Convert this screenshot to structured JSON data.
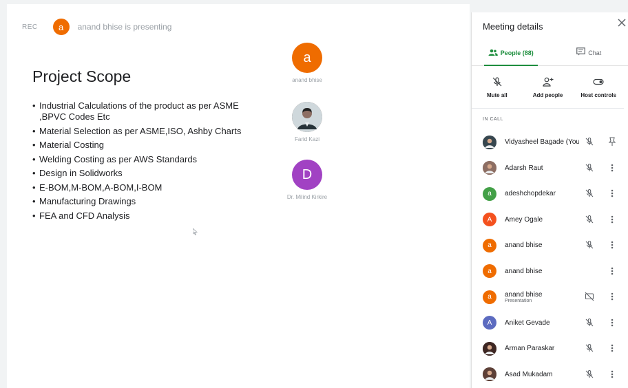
{
  "topbar": {
    "rec_label": "REC",
    "presenter_initial": "a",
    "presenting_text": "anand bhise is presenting"
  },
  "slide": {
    "title": "Project Scope",
    "bullets": [
      "Industrial Calculations  of the product as per ASME ,BPVC Codes Etc",
      "Material Selection as per ASME,ISO, Ashby Charts",
      "Material Costing",
      "Welding Costing as per AWS Standards",
      "Design in Solidworks",
      "E-BOM,M-BOM,A-BOM,I-BOM",
      "Manufacturing Drawings",
      "FEA and CFD Analysis"
    ]
  },
  "tiles": [
    {
      "initial": "a",
      "name": "anand bhise",
      "color": "#ef6c00",
      "photo": false
    },
    {
      "initial": "",
      "name": "Farid Kazi",
      "color": "#6d4c41",
      "photo": true
    },
    {
      "initial": "D",
      "name": "Dr. Milind Kirkire",
      "color": "#a142c3",
      "photo": false
    }
  ],
  "panel": {
    "title": "Meeting details",
    "tabs": [
      {
        "label": "People (88)",
        "active": true,
        "icon": "people-icon"
      },
      {
        "label": "Chat",
        "active": false,
        "icon": "chat-icon"
      }
    ],
    "actions": [
      {
        "label": "Mute all",
        "icon": "mic-off-icon"
      },
      {
        "label": "Add people",
        "icon": "add-person-icon"
      },
      {
        "label": "Host controls",
        "icon": "toggle-icon"
      }
    ],
    "section_label": "IN CALL",
    "people": [
      {
        "name": "Vidyasheel Bagade (You)",
        "sub": "",
        "initial": "",
        "color": "#37474f",
        "photo": true,
        "trailing": "pin"
      },
      {
        "name": "Adarsh Raut",
        "sub": "",
        "initial": "",
        "color": "#8d6e63",
        "photo": true,
        "trailing": "more"
      },
      {
        "name": "adeshchopdekar",
        "sub": "",
        "initial": "a",
        "color": "#43a047",
        "photo": false,
        "trailing": "more"
      },
      {
        "name": "Amey Ogale",
        "sub": "",
        "initial": "A",
        "color": "#f4511e",
        "photo": false,
        "trailing": "more"
      },
      {
        "name": "anand bhise",
        "sub": "",
        "initial": "a",
        "color": "#ef6c00",
        "photo": false,
        "trailing": "more"
      },
      {
        "name": "anand bhise",
        "sub": "",
        "initial": "a",
        "color": "#ef6c00",
        "photo": false,
        "trailing": "more",
        "no_mic": true
      },
      {
        "name": "anand bhise",
        "sub": "Presentation",
        "initial": "a",
        "color": "#ef6c00",
        "photo": false,
        "trailing": "more",
        "present": true
      },
      {
        "name": "Aniket Gevade",
        "sub": "",
        "initial": "A",
        "color": "#5c6bc0",
        "photo": false,
        "trailing": "more"
      },
      {
        "name": "Arman Paraskar",
        "sub": "",
        "initial": "",
        "color": "#3e2723",
        "photo": true,
        "trailing": "more"
      },
      {
        "name": "Asad Mukadam",
        "sub": "",
        "initial": "",
        "color": "#5d4037",
        "photo": true,
        "trailing": "more"
      }
    ]
  }
}
